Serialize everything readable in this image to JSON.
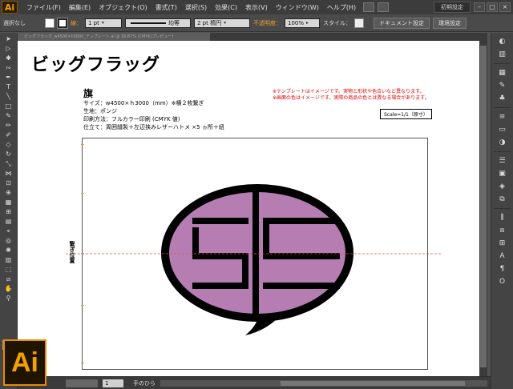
{
  "app": {
    "logo_text": "Ai",
    "workspace_preset": "初期設定"
  },
  "menu": [
    "ファイル(F)",
    "編集(E)",
    "オブジェクト(O)",
    "書式(T)",
    "選択(S)",
    "効果(C)",
    "表示(V)",
    "ウィンドウ(W)",
    "ヘルプ(H)"
  ],
  "window_buttons": [
    "–",
    "□",
    "×"
  ],
  "control_bar": {
    "selection": "選択なし",
    "stroke_label": "線：",
    "stroke_width": "1 pt",
    "stroke_profile": "均等",
    "brush": "2 pt 楕円",
    "opacity_label": "不透明度：",
    "opacity_value": "100%",
    "style_label": "スタイル：",
    "doc_settings": "ドキュメント設定",
    "prefs": "環境設定"
  },
  "tab": {
    "title": "ビッグフラッグ_w4500×h3000_テンプレート.ai @ 16.67% (CMYK/プレビュー)"
  },
  "document": {
    "title": "ビッグフラッグ",
    "spec": {
      "heading": "旗",
      "size": "サイズ：w4500×ｈ3000（mm）※横２枚繋ぎ",
      "material": "生地：ポンジ",
      "print": "印刷方法：フルカラー印刷 (CMYK 値)",
      "finish": "仕立て：周囲縫製＋左辺挟みレザーハトメ ×5 ヵ所＋紐"
    },
    "notes": [
      "※テンプレートはイメージです。実物と形状や色合いなど異なります。",
      "※画面の色はイメージです。実際の商品の色とは異なる場合があります。"
    ],
    "scale": "Scale=1/1（原寸）",
    "seam_label": "繋ぎ位置"
  },
  "colors": {
    "logo_fill": "#b67db3",
    "logo_stroke": "#000000",
    "accent": "#e98a00",
    "seam_line": "#e05050"
  },
  "status": {
    "zoom": "",
    "page": "1",
    "tool": "手のひら"
  }
}
